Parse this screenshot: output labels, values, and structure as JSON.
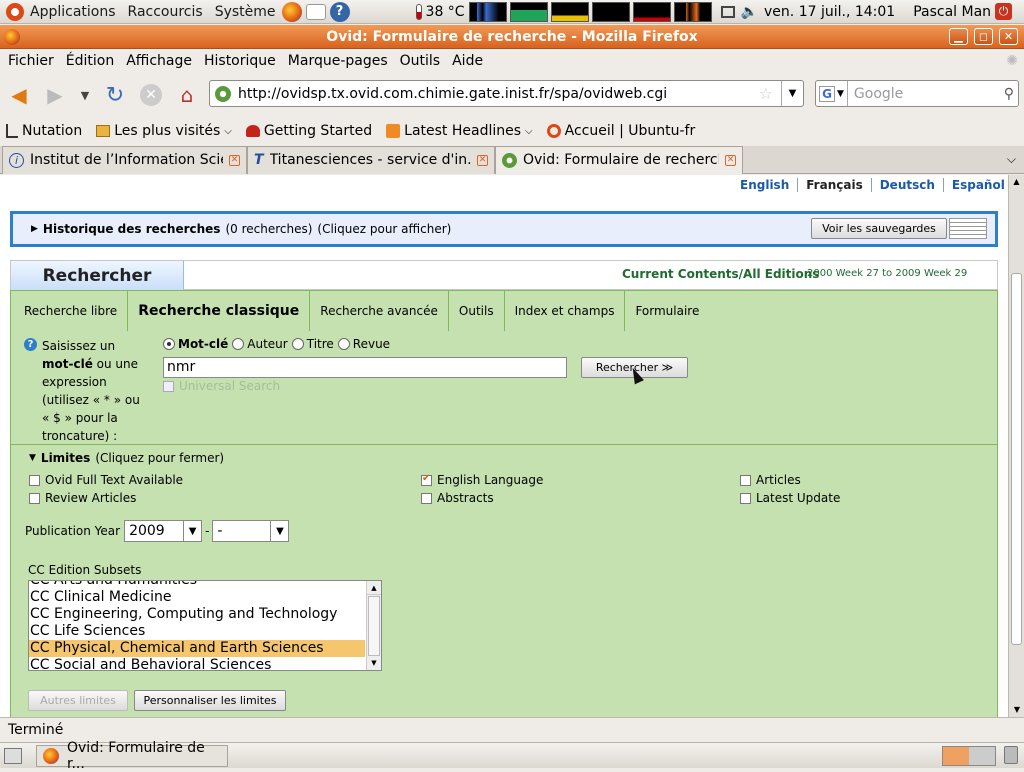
{
  "gnome_panel": {
    "menus": [
      "Applications",
      "Raccourcis",
      "Système"
    ],
    "temperature": "38 °C",
    "clock": "ven. 17 juil., 14:01",
    "user": "Pascal Man"
  },
  "window": {
    "title": "Ovid: Formulaire de recherche - Mozilla Firefox",
    "min": "▁",
    "max": "◻",
    "close": "✕"
  },
  "menubar": {
    "items": [
      "Fichier",
      "Édition",
      "Affichage",
      "Historique",
      "Marque-pages",
      "Outils",
      "Aide"
    ]
  },
  "navbar": {
    "url": "http://ovidsp.tx.ovid.com.chimie.gate.inist.fr/spa/ovidweb.cgi",
    "search_placeholder": "Google",
    "engine": "G"
  },
  "bookmarks": [
    "Nutation",
    "Les plus visités",
    "Getting Started",
    "Latest Headlines",
    "Accueil | Ubuntu-fr"
  ],
  "tabs": [
    {
      "label": "Institut de l’Information Scie..."
    },
    {
      "label": "Titanesciences - service d'in..."
    },
    {
      "label": "Ovid: Formulaire de recherche"
    }
  ],
  "page": {
    "languages": [
      "English",
      "Français",
      "Deutsch",
      "Español"
    ],
    "history": {
      "title": "Historique des recherches",
      "count": "(0 recherches)",
      "hint": "(Cliquez pour afficher)",
      "save_button": "Voir les sauvegardes"
    },
    "search_title": "Rechercher",
    "database": {
      "name": "Current Contents/All Editions",
      "range": "2000 Week 27 to 2009 Week 29"
    },
    "search_tabs": [
      "Recherche libre",
      "Recherche classique",
      "Recherche avancée",
      "Outils",
      "Index et champs",
      "Formulaire"
    ],
    "instructions": {
      "l1": "Saisissez un",
      "l2a": "mot-clé",
      "l2b": " ou une",
      "l3": "expression",
      "l4": "(utilisez « * » ou",
      "l5": "« $ » pour la",
      "l6": "troncature) :"
    },
    "radios": [
      "Mot-clé",
      "Auteur",
      "Titre",
      "Revue"
    ],
    "query": "nmr",
    "universal_search": "Universal Search",
    "search_button": "Rechercher ≫",
    "limits": {
      "title": "Limites",
      "hint": "(Cliquez pour fermer)",
      "checkboxes": [
        {
          "label": "Ovid Full Text Available",
          "checked": false
        },
        {
          "label": "Review Articles",
          "checked": false
        },
        {
          "label": "English Language",
          "checked": true
        },
        {
          "label": "Abstracts",
          "checked": false
        },
        {
          "label": "Articles",
          "checked": false
        },
        {
          "label": "Latest Update",
          "checked": false
        }
      ],
      "pub_year_label": "Publication Year",
      "year_from": "2009",
      "year_to": "-",
      "year_sep": "-",
      "subsets_label": "CC Edition Subsets",
      "subsets": [
        "CC Arts and Humanities",
        "CC Clinical Medicine",
        "CC Engineering, Computing and Technology",
        "CC Life Sciences",
        "CC Physical, Chemical and Earth Sciences",
        "CC Social and Behavioral Sciences"
      ],
      "other_limits_button": "Autres limites",
      "customize_button": "Personnaliser les limites"
    }
  },
  "statusbar": {
    "text": "Terminé"
  },
  "taskbar": {
    "task": "Ovid: Formulaire de r..."
  }
}
